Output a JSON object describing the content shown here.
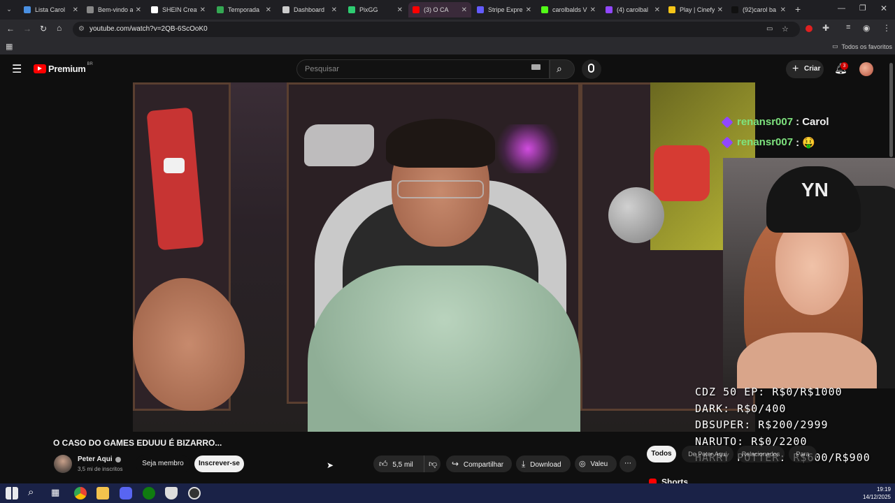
{
  "browser": {
    "tabs": [
      {
        "label": "Lista Carol",
        "color": "#4a90e2"
      },
      {
        "label": "Bem-vindo a",
        "color": "#888888"
      },
      {
        "label": "SHEIN Creat",
        "color": "#ffffff"
      },
      {
        "label": "Temporada",
        "color": "#34a853"
      },
      {
        "label": "Dashboard",
        "color": "#cccccc"
      },
      {
        "label": "PixGG",
        "color": "#2ecc71"
      },
      {
        "label": "(3) O CA",
        "color": "#ff0000"
      },
      {
        "label": "Stripe Expre",
        "color": "#635bff"
      },
      {
        "label": "carolbalds V",
        "color": "#53fc18"
      },
      {
        "label": "(4) carolbal",
        "color": "#9147ff"
      },
      {
        "label": "Play | Cinefy",
        "color": "#f5c518"
      },
      {
        "label": "(92)carol ba",
        "color": "#111111"
      }
    ],
    "url": "youtube.com/watch?v=2QB-6ScOoK0",
    "bookmarks_label": "Todos os favoritos"
  },
  "youtube": {
    "logo_text": "Premium",
    "logo_region": "BR",
    "search_placeholder": "Pesquisar",
    "create_label": "Criar",
    "notifications_count": "3"
  },
  "overlay": {
    "chat": [
      {
        "user": "renansr007",
        "message": ": Carol"
      },
      {
        "user": "renansr007",
        "message": ": 🤑"
      }
    ],
    "stats": [
      "CDZ 50 EP: R$0/R$1000",
      "DARK: R$0/400",
      "DBSUPER: R$200/2999",
      "NARUTO: R$0/2200",
      "HARRY POTTER: R$600/R$900"
    ]
  },
  "video": {
    "title": "O CASO DO GAMES EDUUU É BIZARRO...",
    "channel": "Peter Aqui",
    "subscribers": "3,5 mi de inscritos",
    "join_label": "Seja membro",
    "subscribe_label": "Inscrever-se",
    "likes": "5,5 mil",
    "share_label": "Compartilhar",
    "download_label": "Download",
    "thanks_label": "Valeu"
  },
  "sidebar": {
    "chips": [
      "Todos",
      "De Peter Aqui",
      "Relacionados",
      "Para"
    ],
    "shorts_label": "Shorts"
  },
  "taskbar": {
    "time": "19:19",
    "date": "14/12/2025"
  }
}
